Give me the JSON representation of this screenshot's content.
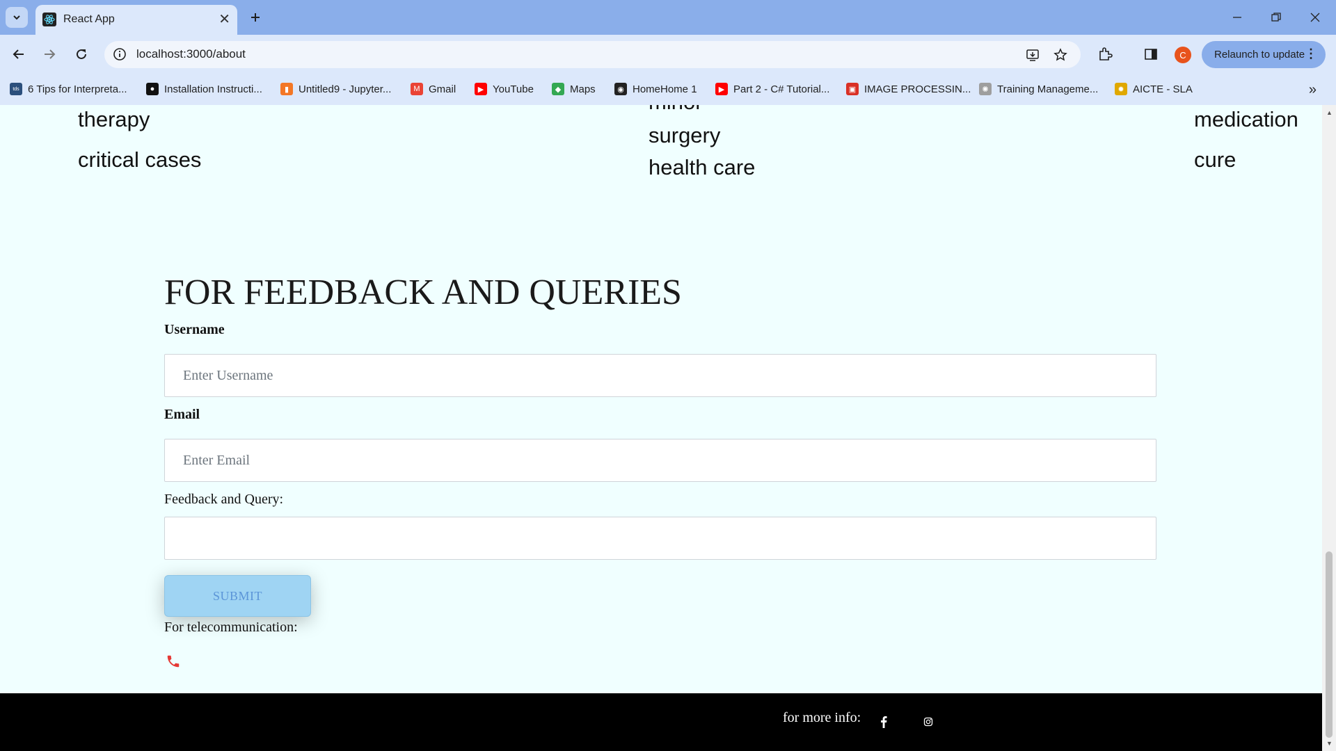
{
  "browser": {
    "tab_title": "React App",
    "url": "localhost:3000/about",
    "relaunch_label": "Relaunch to update",
    "avatar_letter": "C",
    "bookmarks": [
      {
        "label": "6 Tips for Interpreta...",
        "icon": "tds-icon",
        "color": "#2b4f7c"
      },
      {
        "label": "Installation Instructi...",
        "icon": "github-icon",
        "color": "#111111"
      },
      {
        "label": "Untitled9 - Jupyter...",
        "icon": "jupyter-icon",
        "color": "#f37726"
      },
      {
        "label": "Gmail",
        "icon": "gmail-icon",
        "color": "#ea4335"
      },
      {
        "label": "YouTube",
        "icon": "youtube-icon",
        "color": "#ff0000"
      },
      {
        "label": "Maps",
        "icon": "maps-icon",
        "color": "#34a853"
      },
      {
        "label": "HomeHome 1",
        "icon": "globe-icon",
        "color": "#222222"
      },
      {
        "label": "Part 2 - C# Tutorial...",
        "icon": "youtube-icon",
        "color": "#ff0000"
      },
      {
        "label": "IMAGE PROCESSIN...",
        "icon": "pdf-icon",
        "color": "#d93025"
      },
      {
        "label": "Training Manageme...",
        "icon": "seal-icon",
        "color": "#9e9e9e"
      },
      {
        "label": "AICTE - SLA",
        "icon": "aicte-icon",
        "color": "#e0a800"
      }
    ]
  },
  "services": {
    "col1": [
      "therapy",
      "critical cases"
    ],
    "col2": [
      "minor",
      "surgery",
      "health care"
    ],
    "col3": [
      "medication",
      "cure"
    ]
  },
  "form": {
    "title": "FOR FEEDBACK AND QUERIES",
    "username_label": "Username",
    "username_placeholder": "Enter Username",
    "email_label": "Email",
    "email_placeholder": "Enter Email",
    "feedback_label": "Feedback and Query:",
    "submit_label": "SUBMIT",
    "telecom_label": "For telecommunication:"
  },
  "footer": {
    "more_info": "for more info:"
  },
  "colors": {
    "page_bg": "#f0ffff",
    "tabstrip": "#8aaeea",
    "submit_bg": "#9fd4f3",
    "phone": "#e53935"
  }
}
